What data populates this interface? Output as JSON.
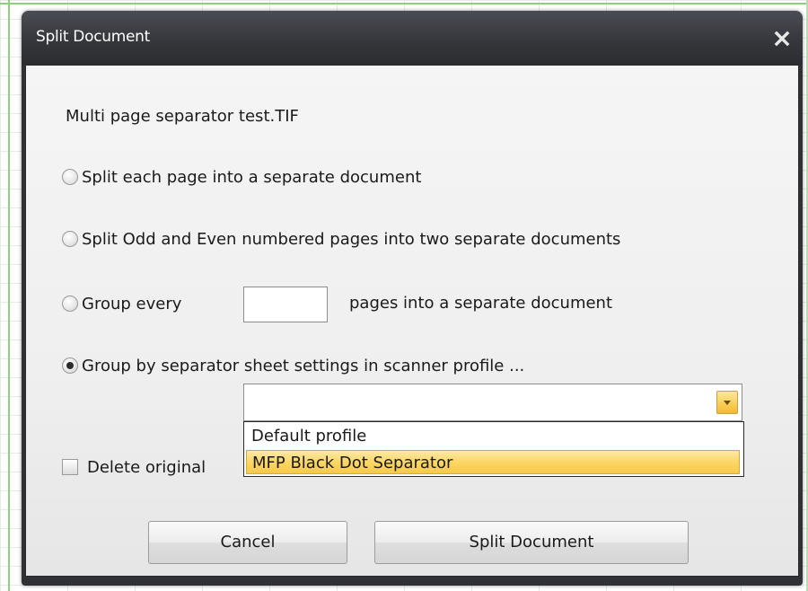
{
  "dialog": {
    "title": "Split Document",
    "close_icon": "close-x-icon"
  },
  "filename": "Multi page separator test.TIF",
  "options": {
    "split_each": "Split each page into a separate document",
    "split_odd_even": "Split Odd and Even numbered pages into two separate documents",
    "group_every": "Group every",
    "group_every_suffix": "pages into a separate document",
    "group_every_value": "",
    "group_by_separator": "Group by separator sheet settings in scanner profile ...",
    "selected_option": "group_by_separator"
  },
  "profile_dropdown": {
    "value": "",
    "items": [
      "Default profile",
      "MFP Black Dot Separator"
    ],
    "highlighted_index": 1
  },
  "delete_original_label": "Delete original",
  "buttons": {
    "cancel": "Cancel",
    "split": "Split Document"
  },
  "colors": {
    "titlebar": "#35373c",
    "highlight": "#fbd765",
    "grid_green": "#8fd07f"
  }
}
